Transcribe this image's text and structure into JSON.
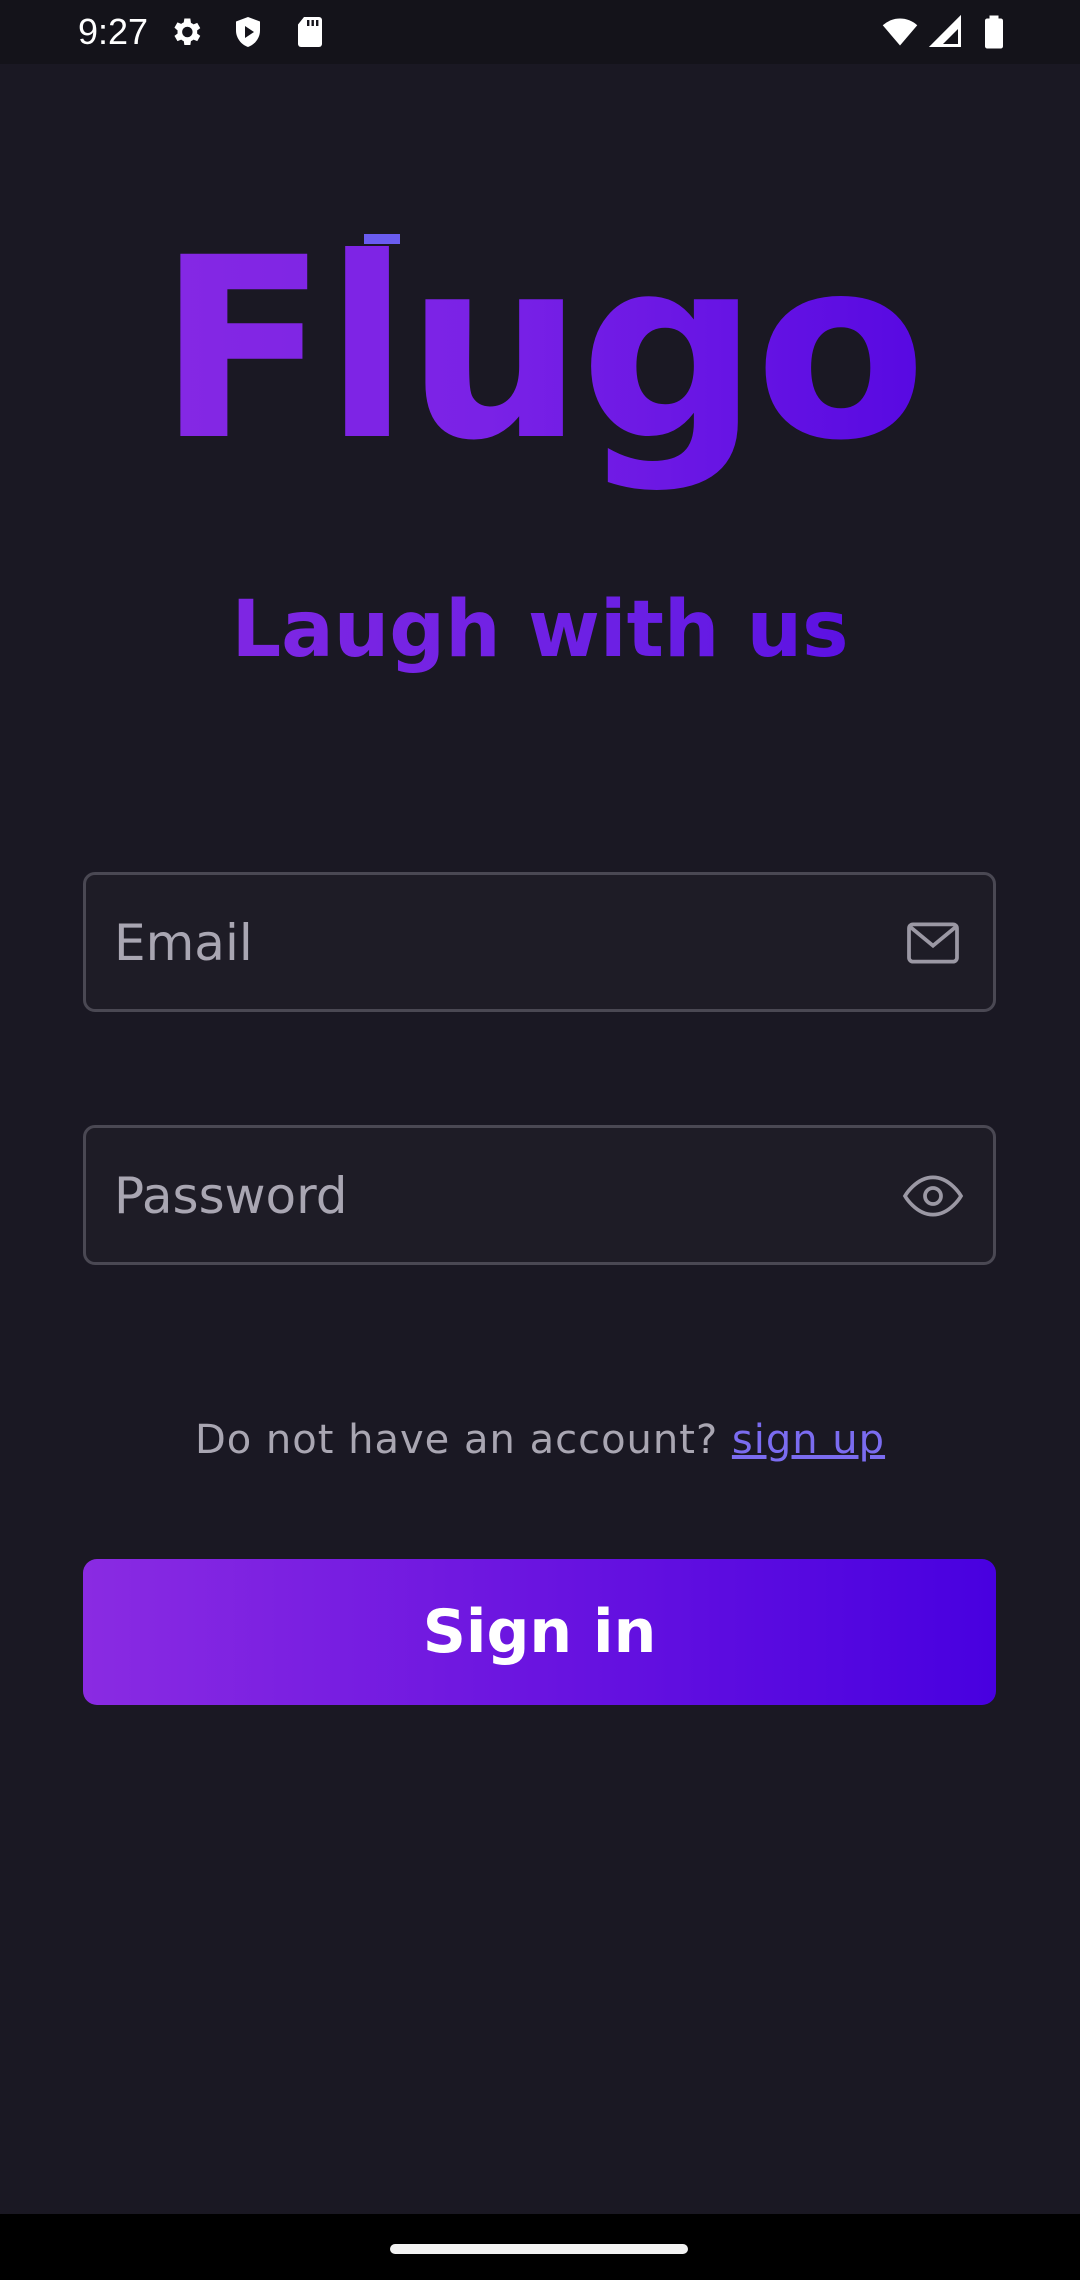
{
  "status_bar": {
    "time": "9:27",
    "icons_left": [
      "settings-icon",
      "shield-play-icon",
      "sd-card-icon"
    ],
    "icons_right": [
      "wifi-icon",
      "signal-icon",
      "battery-icon"
    ]
  },
  "brand": {
    "logo": "Flugo",
    "tagline": "Laugh with us",
    "gradient_start": "#8a2be2",
    "gradient_end": "#4b00e0"
  },
  "form": {
    "email": {
      "placeholder": "Email",
      "value": "",
      "icon": "mail-icon"
    },
    "password": {
      "placeholder": "Password",
      "value": "",
      "icon": "eye-icon"
    }
  },
  "account_prompt": {
    "text": "Do not have an account?",
    "link": "sign up",
    "link_color": "#7b6cf0"
  },
  "signin_button": {
    "label": "Sign in"
  },
  "colors": {
    "background": "#1a1823",
    "field_border": "#4a4853",
    "placeholder": "#a9a6b2"
  }
}
